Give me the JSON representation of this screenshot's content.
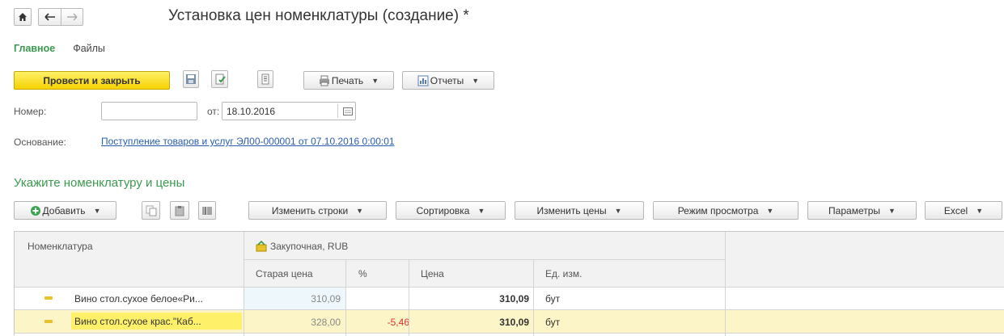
{
  "window": {
    "title": "Установка цен номенклатуры (создание) *"
  },
  "tabs": [
    {
      "label": "Главное",
      "active": true
    },
    {
      "label": "Файлы",
      "active": false
    }
  ],
  "toolbar": {
    "post_close_label": "Провести и закрыть",
    "print_label": "Печать",
    "reports_label": "Отчеты"
  },
  "form": {
    "number_label": "Номер:",
    "number_value": "",
    "from_label": "от:",
    "date_value": "18.10.2016",
    "basis_label": "Основание:",
    "basis_link": "Поступление товаров и услуг ЭЛ00-000001 от 07.10.2016 0:00:01"
  },
  "section_title": "Укажите номенклатуру и цены",
  "table_toolbar": {
    "add_label": "Добавить",
    "change_rows_label": "Изменить строки",
    "sort_label": "Сортировка",
    "change_prices_label": "Изменить цены",
    "view_mode_label": "Режим просмотра",
    "params_label": "Параметры",
    "excel_label": "Excel"
  },
  "table": {
    "col_nomenclature": "Номенклатура",
    "price_type": "Закупочная, RUB",
    "col_old_price": "Старая цена",
    "col_percent": "%",
    "col_price": "Цена",
    "col_unit": "Ед. изм.",
    "rows": [
      {
        "name": "Вино стол.сухое белое«Ри...",
        "old_price": "310,09",
        "percent": "",
        "price": "310,09",
        "unit": "бут"
      },
      {
        "name": "Вино стол.сухое крас.\"Каб...",
        "old_price": "328,00",
        "percent": "-5,46",
        "price": "310,09",
        "unit": "бут"
      }
    ]
  },
  "colors": {
    "accent_green": "#3a9a4e",
    "primary_yellow": "#f5d200",
    "link_blue": "#2a5db0",
    "negative_red": "#e03030",
    "selected_row": "#fbf5c8",
    "old_price_bg": "#eef7fb"
  }
}
